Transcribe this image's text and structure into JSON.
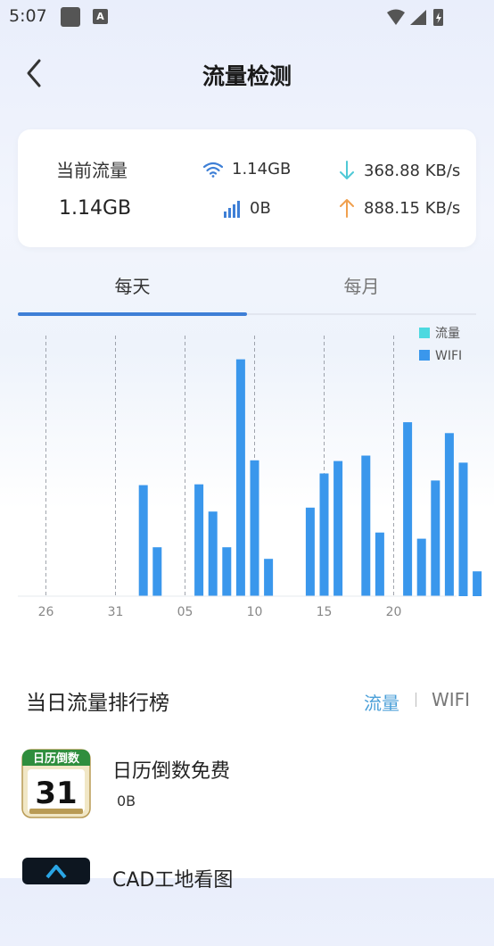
{
  "status_bar": {
    "time": "5:07",
    "icon_a": "A"
  },
  "header": {
    "title": "流量检测"
  },
  "stats": {
    "current_label": "当前流量",
    "current_value": "1.14GB",
    "wifi_usage": "1.14GB",
    "cellular_usage": "0B",
    "download_speed": "368.88 KB/s",
    "upload_speed": "888.15 KB/s"
  },
  "tabs": {
    "daily": "每天",
    "monthly": "每月",
    "selected": "daily"
  },
  "colors": {
    "accent": "#3e7fd6",
    "traffic": "#4dd9e0",
    "wifi": "#3a97ec",
    "toggle_active": "#4a9fd8"
  },
  "chart_data": {
    "type": "bar",
    "x_tick_labels": [
      "26",
      "31",
      "05",
      "10",
      "15",
      "20"
    ],
    "legend": [
      "流量",
      "WIFI"
    ],
    "legend_position": "top-right",
    "grid": "vertical dashed lines at tick labels",
    "series": [
      {
        "name": "WIFI",
        "days": [
          1,
          2,
          3,
          4,
          5,
          6,
          7,
          8,
          9,
          10,
          11,
          12,
          13,
          14,
          15,
          16,
          17,
          18,
          19,
          20,
          21,
          22,
          23,
          24,
          25,
          26,
          27,
          28,
          29,
          30
        ],
        "values": [
          0,
          0,
          0,
          0,
          0,
          0,
          0,
          143,
          63,
          0,
          0,
          144,
          109,
          63,
          305,
          175,
          48,
          0,
          0,
          114,
          158,
          174,
          0,
          181,
          82,
          0,
          224,
          74,
          149,
          210,
          172,
          32
        ]
      },
      {
        "name": "流量",
        "values": []
      }
    ]
  },
  "ranking": {
    "title": "当日流量排行榜",
    "toggle_traffic": "流量",
    "toggle_wifi": "WIFI",
    "apps": [
      {
        "icon_banner": "日历倒数",
        "icon_number": "31",
        "name": "日历倒数免费",
        "usage": "0B"
      },
      {
        "name": "CAD工地看图",
        "usage": ""
      }
    ]
  }
}
